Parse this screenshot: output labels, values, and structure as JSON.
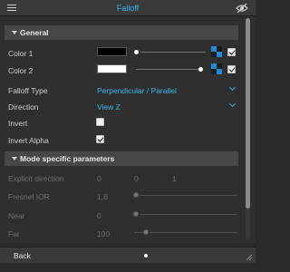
{
  "header": {
    "title": "Falloff",
    "menu_icon": "hamburger-icon",
    "visibility_icon": "eye-slash-icon"
  },
  "sections": {
    "general": "General",
    "mode_specific": "Mode specific parameters"
  },
  "general": {
    "color1": {
      "label": "Color 1",
      "swatch": "#000000",
      "checked": true
    },
    "color2": {
      "label": "Color 2",
      "swatch": "#ffffff",
      "checked": true
    },
    "falloff_type": {
      "label": "Falloff Type",
      "value": "Perpendicular / Parallel"
    },
    "direction": {
      "label": "Direction",
      "value": "View Z"
    },
    "invert": {
      "label": "Invert",
      "checked": false
    },
    "invert_alpha": {
      "label": "Invert Alpha",
      "checked": true
    }
  },
  "mode_specific": {
    "explicit_direction": {
      "label": "Explicit direction",
      "x": "0",
      "y": "0",
      "z": "1"
    },
    "fresnel_ior": {
      "label": "Fresnel IOR",
      "value": "1,6"
    },
    "near": {
      "label": "Near",
      "value": "0"
    },
    "far": {
      "label": "Far",
      "value": "100"
    }
  },
  "footer": {
    "back_label": "Back"
  },
  "colors": {
    "accent": "#39b5ef",
    "map_icon_blue": "#1f8bd6"
  }
}
